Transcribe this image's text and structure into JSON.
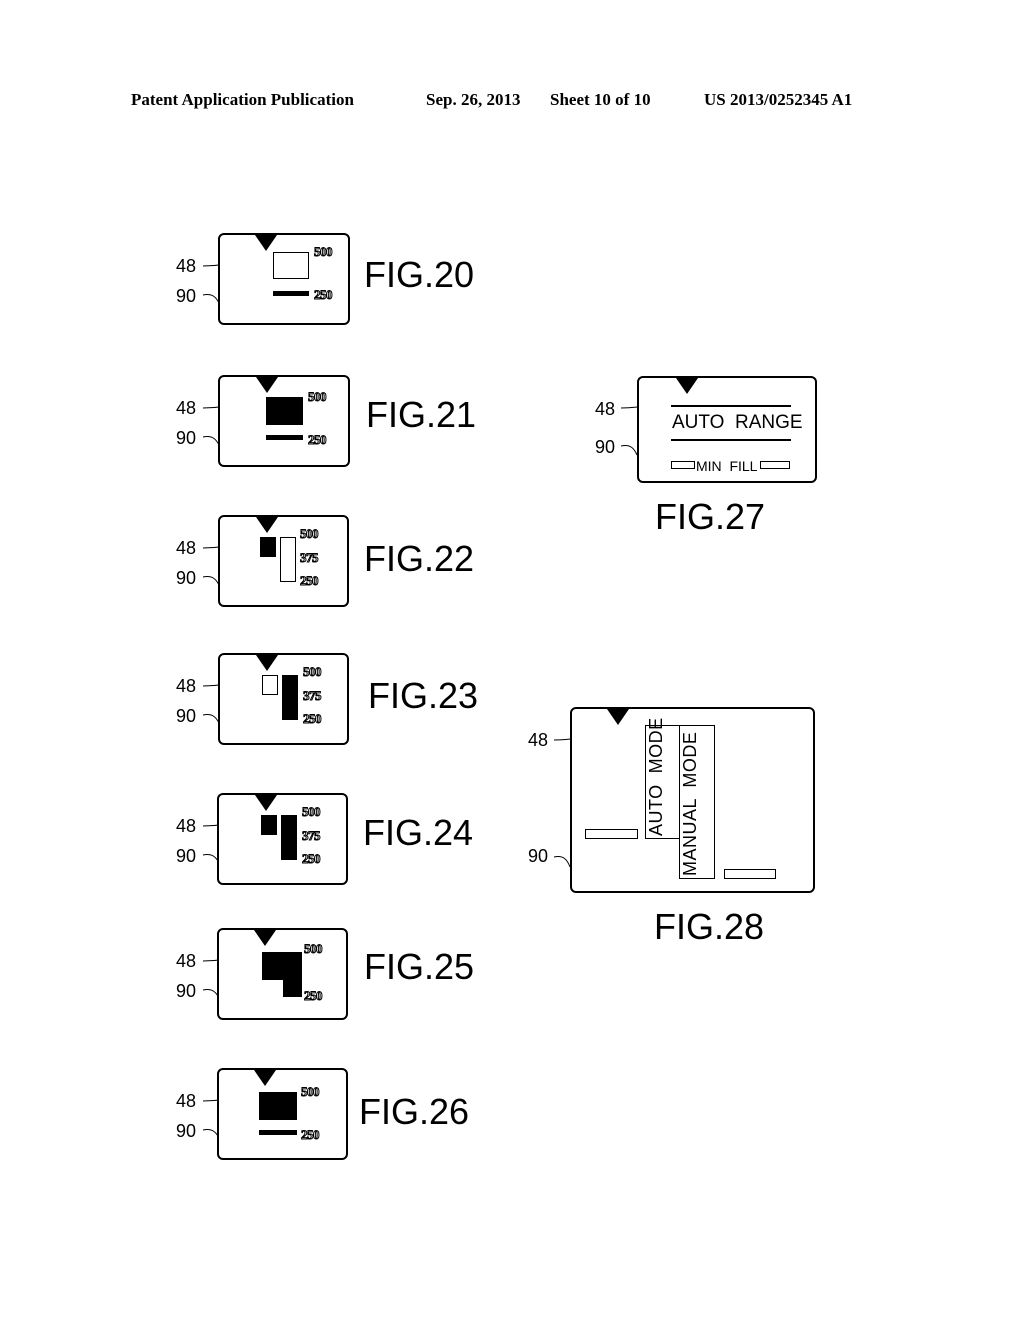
{
  "header": {
    "publication": "Patent Application Publication",
    "date": "Sep. 26, 2013",
    "sheet": "Sheet 10 of 10",
    "number": "US 2013/0252345 A1"
  },
  "reference_numerals": {
    "pointer": "48",
    "display": "90"
  },
  "figures": [
    {
      "id": "fig20",
      "label": "FIG.20",
      "ticks": [
        "500",
        "250"
      ]
    },
    {
      "id": "fig21",
      "label": "FIG.21",
      "ticks": [
        "500",
        "250"
      ]
    },
    {
      "id": "fig22",
      "label": "FIG.22",
      "ticks": [
        "500",
        "375",
        "250"
      ]
    },
    {
      "id": "fig23",
      "label": "FIG.23",
      "ticks": [
        "500",
        "375",
        "250"
      ]
    },
    {
      "id": "fig24",
      "label": "FIG.24",
      "ticks": [
        "500",
        "375",
        "250"
      ]
    },
    {
      "id": "fig25",
      "label": "FIG.25",
      "ticks": [
        "500",
        "250"
      ]
    },
    {
      "id": "fig26",
      "label": "FIG.26",
      "ticks": [
        "500",
        "250"
      ]
    },
    {
      "id": "fig27",
      "label": "FIG.27",
      "auto_range": "AUTO  RANGE",
      "min_fill": "MIN  FILL"
    },
    {
      "id": "fig28",
      "label": "FIG.28",
      "auto_mode": "AUTO  MODE",
      "manual_mode": "MANUAL  MODE"
    }
  ]
}
